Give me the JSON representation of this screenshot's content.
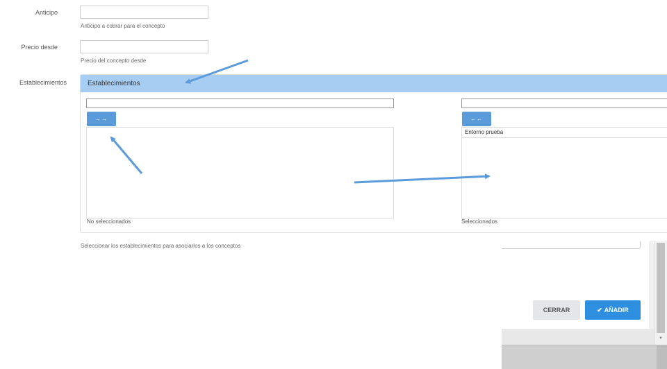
{
  "fields": {
    "anticipo": {
      "label": "Anticipo",
      "value": "",
      "help": "Anticipo a cobrar para el concepto"
    },
    "precio_desde": {
      "label": "Precio desde",
      "value": "",
      "help": "Precio del concepto desde"
    },
    "establecimientos": {
      "label": "Establecimientos",
      "help": "Seleccionar los establecimientos para asociarlos a los conceptos"
    }
  },
  "dual_list": {
    "panel_title": "Establecimientos",
    "left": {
      "filter_value": "",
      "button_icon": "double-arrow-right-icon",
      "button_glyph": "→→",
      "items": [],
      "caption": "No seleccionados"
    },
    "right": {
      "filter_value": "",
      "button_icon": "double-arrow-left-icon",
      "button_glyph": "←←",
      "items": [
        "Entorno prueba"
      ],
      "caption": "Seleccionados"
    }
  },
  "modal": {
    "cerrar_label": "CERRAR",
    "anadir_label": "AÑADIR",
    "anadir_icon": "check-icon"
  },
  "annotations": {
    "arrow_color": "#5b9bd9"
  },
  "colors": {
    "panel_header": "#a8cdf2",
    "dual_button": "#5b9bd9",
    "primary_button": "#2e8fe0",
    "secondary_button": "#e4e6ea"
  }
}
